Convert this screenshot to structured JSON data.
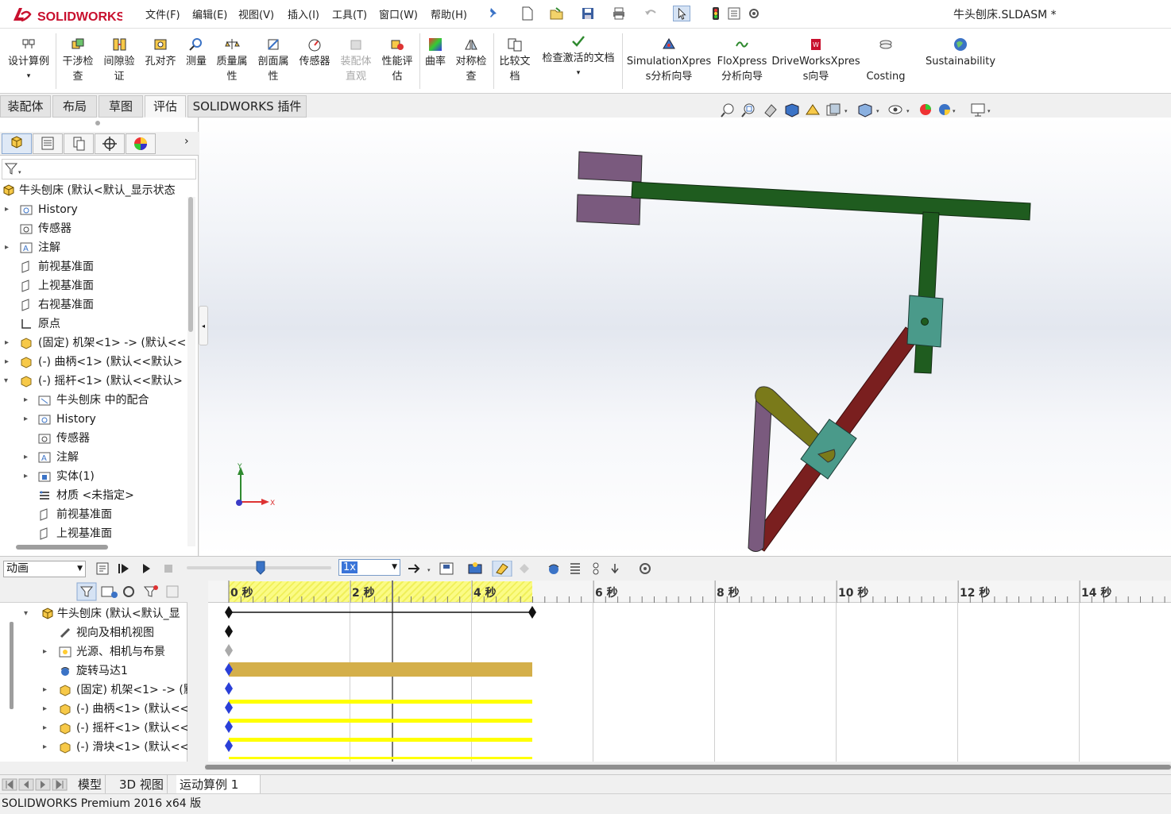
{
  "app": {
    "brand": "SOLIDWORKS",
    "document_title": "牛头刨床.SLDASM *"
  },
  "menu": [
    {
      "label": "文件(F)"
    },
    {
      "label": "编辑(E)"
    },
    {
      "label": "视图(V)"
    },
    {
      "label": "插入(I)"
    },
    {
      "label": "工具(T)"
    },
    {
      "label": "窗口(W)"
    },
    {
      "label": "帮助(H)"
    }
  ],
  "ribbon": {
    "design_study": "设计算例",
    "interference_check": "干涉检查",
    "clearance_verify": "间隙验证",
    "hole_align": "孔对齐",
    "measure": "测量",
    "mass_props": "质量属性",
    "section_props": "剖面属性",
    "sensor": "传感器",
    "assembly_visualization": "装配体直观",
    "performance_eval": "性能评估",
    "curvature": "曲率",
    "symmetry_check": "对称检查",
    "compare_docs": "比较文档",
    "check_active_doc": "检查激活的文档",
    "simulation_xpress": "SimulationXpress分析向导",
    "floxpress": "FloXpress分析向导",
    "driveworks": "DriveWorksXpress向导",
    "costing": "Costing",
    "sustainability": "Sustainability"
  },
  "command_tabs": [
    "装配体",
    "布局",
    "草图",
    "评估",
    "SOLIDWORKS 插件"
  ],
  "feature_tree": {
    "root": "牛头刨床  (默认<默认_显示状态",
    "items": [
      {
        "label": "History"
      },
      {
        "label": "传感器"
      },
      {
        "label": "注解"
      },
      {
        "label": "前视基准面"
      },
      {
        "label": "上视基准面"
      },
      {
        "label": "右视基准面"
      },
      {
        "label": "原点"
      },
      {
        "label": "(固定) 机架<1> -> (默认<<"
      },
      {
        "label": "(-) 曲柄<1> (默认<<默认>"
      },
      {
        "label": "(-) 摇杆<1> (默认<<默认>"
      },
      {
        "label": "牛头刨床 中的配合"
      },
      {
        "label": "History"
      },
      {
        "label": "传感器"
      },
      {
        "label": "注解"
      },
      {
        "label": "实体(1)"
      },
      {
        "label": "材质 <未指定>"
      },
      {
        "label": "前视基准面"
      },
      {
        "label": "上视基准面"
      }
    ]
  },
  "triad": {
    "x": "X",
    "y": "Y"
  },
  "motion": {
    "study_type": "动画",
    "speed": "1x",
    "slider_fraction": 0.51,
    "tree": [
      {
        "label": "牛头刨床  (默认<默认_显"
      },
      {
        "label": "视向及相机视图"
      },
      {
        "label": "光源、相机与布景"
      },
      {
        "label": "旋转马达1"
      },
      {
        "label": "(固定) 机架<1> -> (默"
      },
      {
        "label": "(-) 曲柄<1> (默认<<"
      },
      {
        "label": "(-) 摇杆<1> (默认<<"
      },
      {
        "label": "(-) 滑块<1> (默认<<"
      }
    ],
    "time_labels": [
      "0 秒",
      "2 秒",
      "4 秒",
      "6 秒",
      "8 秒",
      "10 秒",
      "12 秒",
      "14 秒"
    ]
  },
  "bottom_tabs": [
    "模型",
    "3D 视图",
    "运动算例 1"
  ],
  "status": "SOLIDWORKS Premium 2016 x64 版",
  "colors": {
    "accent": "#c8102e",
    "rod_green": "#1f5c1f",
    "crank_olive": "#7a7a1a",
    "rocker_red": "#7a1f1f",
    "slider_teal": "#4a9a8a",
    "block_purple": "#7a5a7e"
  }
}
